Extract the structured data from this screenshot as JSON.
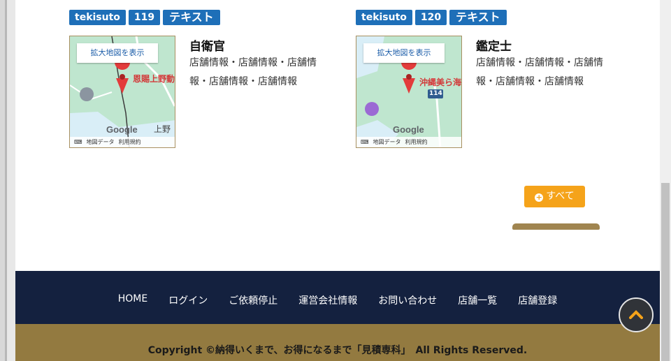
{
  "cards": [
    {
      "tag_user": "tekisuto",
      "tag_id": "119",
      "tag_type": "テキスト",
      "map_button": "拡大地図を表示",
      "map_place": "恩賜上野動",
      "map_place2": "上野",
      "map_google": "Google",
      "map_footer": [
        "⌨",
        "地図データ",
        "利用規約"
      ],
      "title": "自衛官",
      "description": "店舗情報・店舗情報・店舗情報・店舗情報・店舗情報"
    },
    {
      "tag_user": "tekisuto",
      "tag_id": "120",
      "tag_type": "テキスト",
      "map_button": "拡大地図を表示",
      "map_place": "沖縄美ら海",
      "map_place2": "",
      "map_road": "114",
      "map_google": "Google",
      "map_footer": [
        "⌨",
        "地図データ",
        "利用規約"
      ],
      "title": "鑑定士",
      "description": "店舗情報・店舗情報・店舗情報・店舗情報・店舗情報"
    }
  ],
  "all_button": "すべて",
  "nav": [
    "HOME",
    "ログイン",
    "ご依頼停止",
    "運営会社情報",
    "お問い合わせ",
    "店舗一覧",
    "店舗登録"
  ],
  "copyright": "Copyright ©納得いくまで、お得になるまで「見積専科」　All Rights Reserved.",
  "to_top_icon": "chevron-up-icon",
  "colors": {
    "tag": "#1e6fb8",
    "accent": "#f5a31a",
    "nav_bg": "#14213f",
    "footer_bg": "#937a40"
  }
}
